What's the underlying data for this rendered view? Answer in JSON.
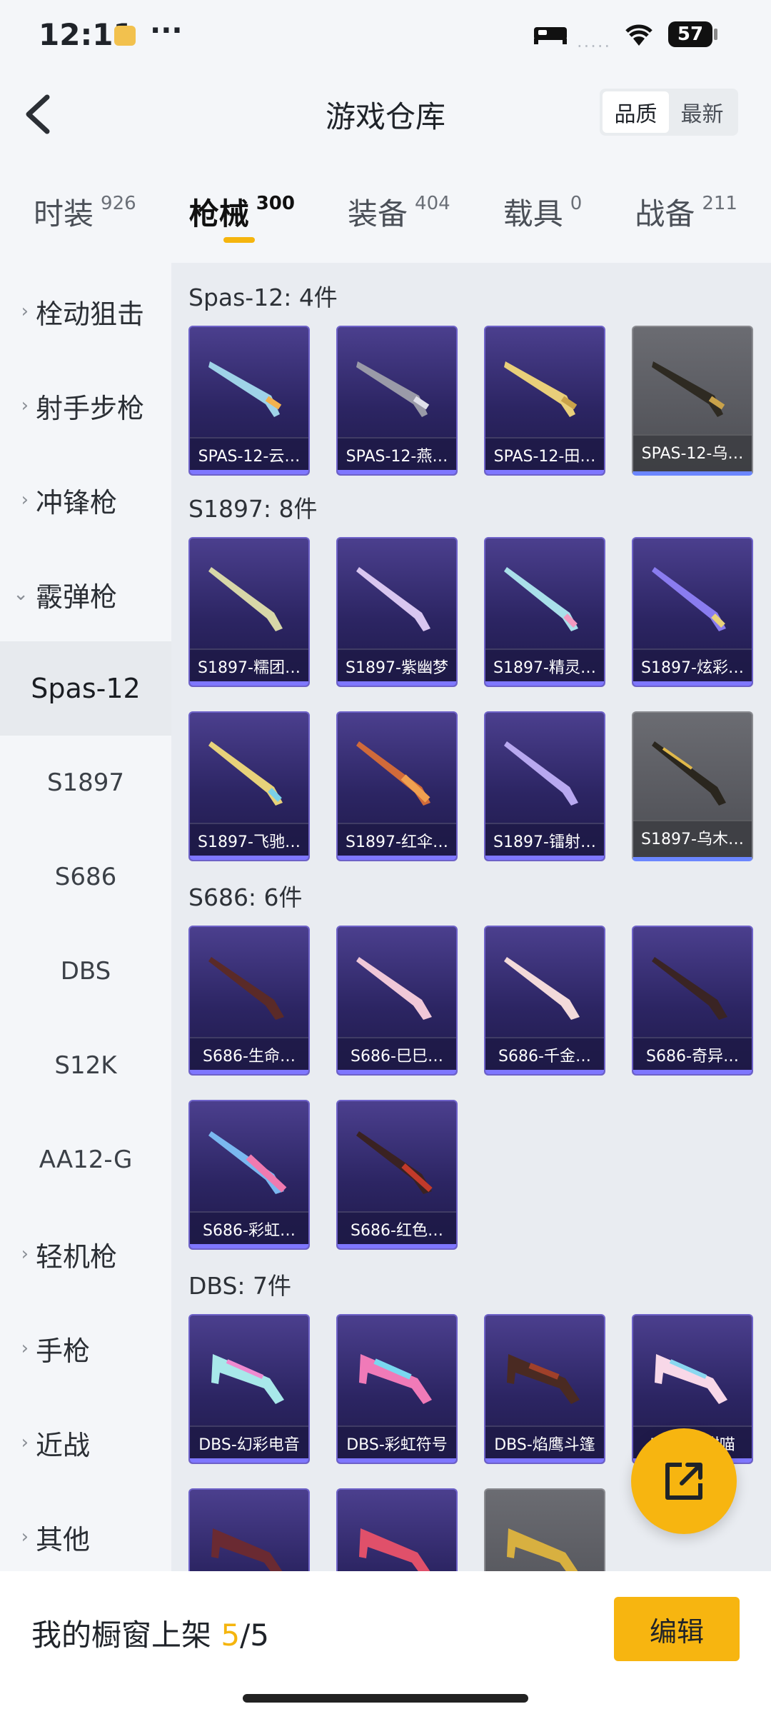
{
  "status_bar": {
    "time": "12:11",
    "dots": "···",
    "battery": "57",
    "signal": "....."
  },
  "header": {
    "title": "游戏仓库",
    "sort_options": [
      "品质",
      "最新"
    ]
  },
  "categories": [
    {
      "label": "时装",
      "count": "926"
    },
    {
      "label": "枪械",
      "count": "300"
    },
    {
      "label": "装备",
      "count": "404"
    },
    {
      "label": "载具",
      "count": "0"
    },
    {
      "label": "战备",
      "count": "211"
    }
  ],
  "sidebar": {
    "items": [
      {
        "label": "栓动狙击",
        "chev": "›"
      },
      {
        "label": "射手步枪",
        "chev": "›"
      },
      {
        "label": "冲锋枪",
        "chev": "›"
      },
      {
        "label": "霰弹枪",
        "chev": "⌄"
      },
      {
        "label": "Spas-12"
      },
      {
        "label": "S1897"
      },
      {
        "label": "S686"
      },
      {
        "label": "DBS"
      },
      {
        "label": "S12K"
      },
      {
        "label": "AA12-G"
      },
      {
        "label": "轻机枪",
        "chev": "›"
      },
      {
        "label": "手枪",
        "chev": "›"
      },
      {
        "label": "近战",
        "chev": "›"
      },
      {
        "label": "其他",
        "chev": "›"
      }
    ]
  },
  "groups": [
    {
      "title": "Spas-12: 4件",
      "items": [
        "SPAS-12-云…",
        "SPAS-12-燕…",
        "SPAS-12-田…",
        "SPAS-12-乌…"
      ]
    },
    {
      "title": "S1897: 8件",
      "items": [
        "S1897-糯团…",
        "S1897-紫幽梦",
        "S1897-精灵…",
        "S1897-炫彩…",
        "S1897-飞驰…",
        "S1897-红伞…",
        "S1897-镭射…",
        "S1897-乌木…"
      ]
    },
    {
      "title": "S686: 6件",
      "items": [
        "S686-生命…",
        "S686-巳巳…",
        "S686-千金…",
        "S686-奇异…",
        "S686-彩虹…",
        "S686-红色…"
      ]
    },
    {
      "title": "DBS: 7件",
      "items": [
        "DBS-幻彩电音",
        "DBS-彩虹符号",
        "DBS-焰鹰斗篷",
        "DBS-甜甜喵",
        "",
        "",
        ""
      ]
    }
  ],
  "bottom": {
    "label": "我的橱窗上架 ",
    "count": "5",
    "total": "/5",
    "edit": "编辑"
  },
  "colors": {
    "accent": "#f7b510",
    "card_purple": "#2c2563",
    "card_gray": "#55565c"
  }
}
